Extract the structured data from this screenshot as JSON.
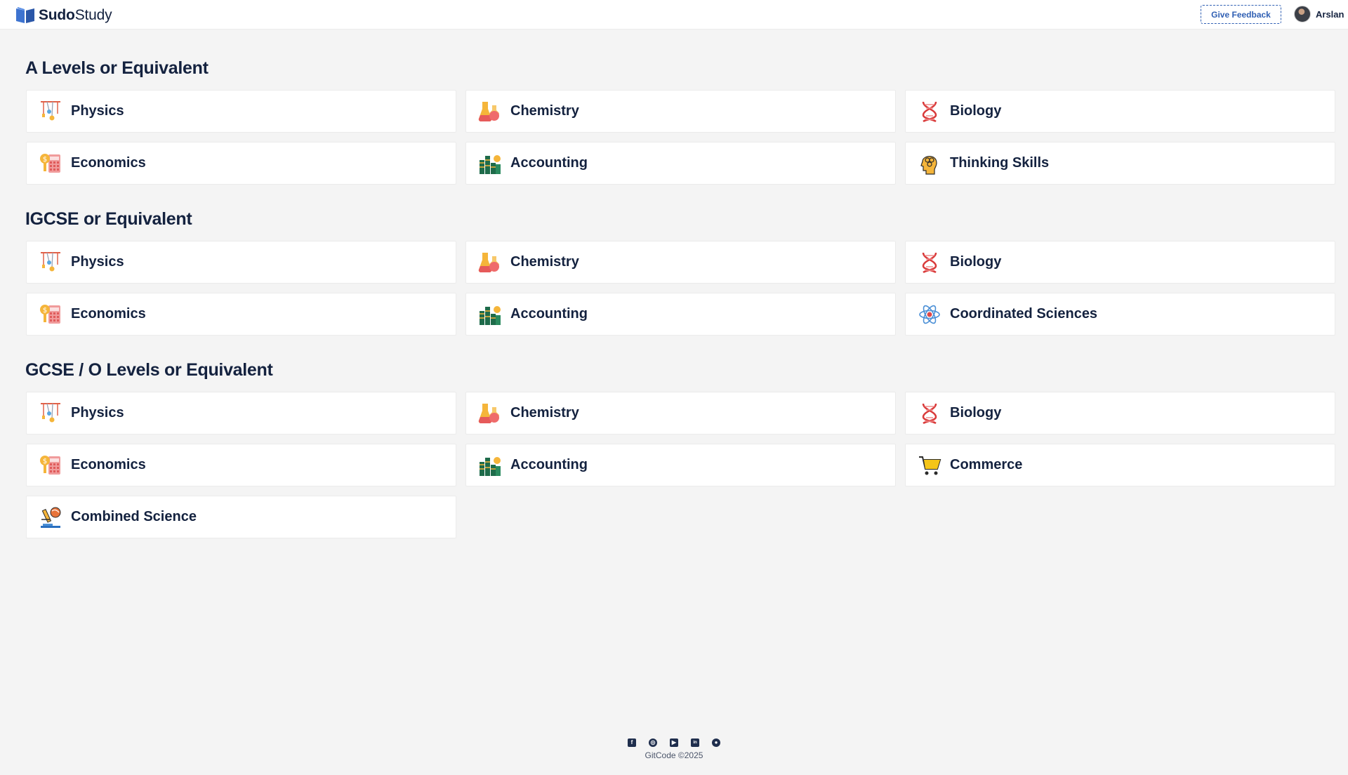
{
  "header": {
    "logo_bold": "Sudo",
    "logo_rest": "Study",
    "feedback_label": "Give Feedback",
    "user_name": "Arslan"
  },
  "sections": [
    {
      "title": "A Levels or Equivalent",
      "items": [
        {
          "label": "Physics",
          "icon": "physics-icon"
        },
        {
          "label": "Chemistry",
          "icon": "chemistry-flask-icon"
        },
        {
          "label": "Biology",
          "icon": "dna-icon"
        },
        {
          "label": "Economics",
          "icon": "economics-calculator-icon"
        },
        {
          "label": "Accounting",
          "icon": "accounting-coins-icon"
        },
        {
          "label": "Thinking Skills",
          "icon": "thinking-head-icon"
        }
      ]
    },
    {
      "title": "IGCSE or Equivalent",
      "items": [
        {
          "label": "Physics",
          "icon": "physics-icon"
        },
        {
          "label": "Chemistry",
          "icon": "chemistry-flask-icon"
        },
        {
          "label": "Biology",
          "icon": "dna-icon"
        },
        {
          "label": "Economics",
          "icon": "economics-calculator-icon"
        },
        {
          "label": "Accounting",
          "icon": "accounting-coins-icon"
        },
        {
          "label": "Coordinated Sciences",
          "icon": "atom-icon"
        }
      ]
    },
    {
      "title": "GCSE / O Levels or Equivalent",
      "items": [
        {
          "label": "Physics",
          "icon": "physics-icon"
        },
        {
          "label": "Chemistry",
          "icon": "chemistry-flask-icon"
        },
        {
          "label": "Biology",
          "icon": "dna-icon"
        },
        {
          "label": "Economics",
          "icon": "economics-calculator-icon"
        },
        {
          "label": "Accounting",
          "icon": "accounting-coins-icon"
        },
        {
          "label": "Commerce",
          "icon": "shopping-cart-icon"
        },
        {
          "label": "Combined Science",
          "icon": "microscope-icon"
        }
      ]
    }
  ],
  "footer": {
    "social": [
      "facebook-icon",
      "instagram-icon",
      "youtube-icon",
      "linkedin-icon",
      "reddit-icon"
    ],
    "copyright": "GitCode ©2025"
  }
}
